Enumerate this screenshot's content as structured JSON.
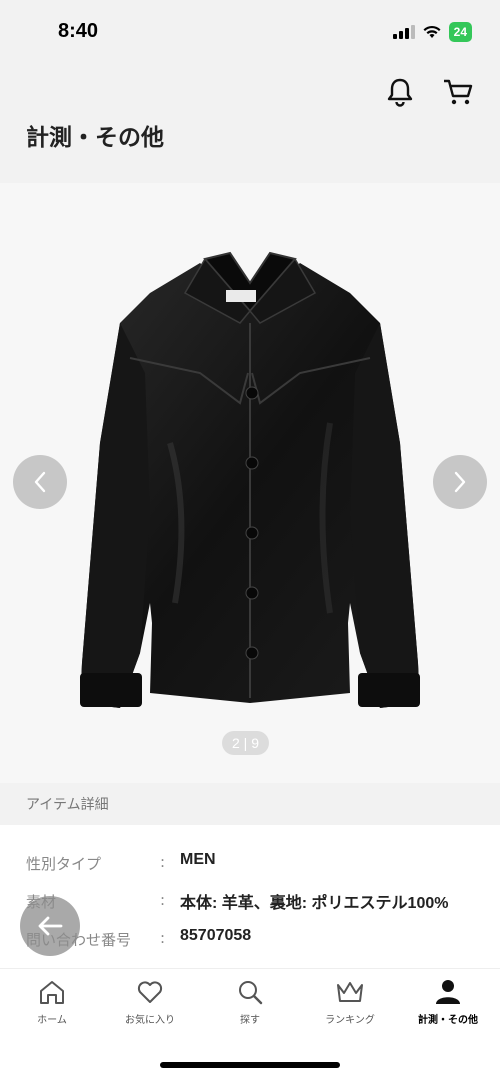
{
  "status": {
    "time": "8:40",
    "battery": "24"
  },
  "header": {
    "title": "計測・その他",
    "bell_icon": "bell-icon",
    "cart_icon": "cart-icon"
  },
  "gallery": {
    "counter": "2 | 9",
    "current": 2,
    "total": 9,
    "image": "black-leather-shirt-jacket"
  },
  "section": {
    "title": "アイテム詳細"
  },
  "details": [
    {
      "label": "性別タイプ",
      "value": "MEN"
    },
    {
      "label": "素材",
      "value": "本体: 羊革、裏地: ポリエステル100%"
    },
    {
      "label": "問い合わせ番号",
      "value": "85707058"
    }
  ],
  "tabs": [
    {
      "label": "ホーム",
      "icon": "home-icon"
    },
    {
      "label": "お気に入り",
      "icon": "heart-icon"
    },
    {
      "label": "探す",
      "icon": "search-icon"
    },
    {
      "label": "ランキング",
      "icon": "crown-icon"
    },
    {
      "label": "計測・その他",
      "icon": "person-icon",
      "active": true
    }
  ]
}
